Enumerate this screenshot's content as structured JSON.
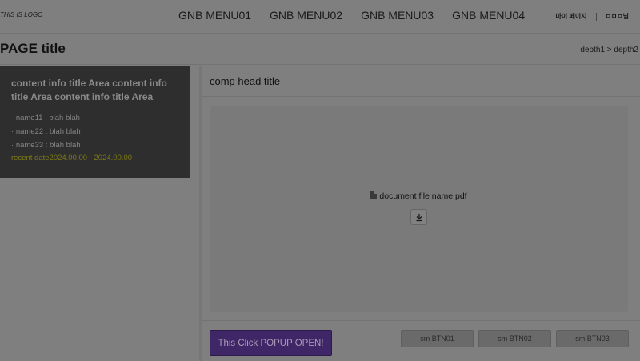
{
  "header": {
    "logo": "THIS IS LOGO",
    "menu": [
      {
        "label": "GNB MENU01"
      },
      {
        "label": "GNB MENU02"
      },
      {
        "label": "GNB MENU03"
      },
      {
        "label": "GNB MENU04"
      }
    ],
    "util": {
      "mypage": "마이 페이지",
      "user": "ㅁㅁㅁ님"
    }
  },
  "page": {
    "title": "PAGE title",
    "breadcrumb": "depth1 > depth2"
  },
  "info_panel": {
    "title": "content info title Area content info title Area content info title Area content in…",
    "items": [
      {
        "label": "name11 : blah blah"
      },
      {
        "label": "name22 : blah blah"
      },
      {
        "label": "name33 : blah blah"
      }
    ],
    "recent_date": "recent date2024.00.00 - 2024.00.00"
  },
  "comp": {
    "title": "comp head title",
    "file_name": "document file name.pdf",
    "file_icon": "document-icon",
    "download_icon": "download-icon"
  },
  "buttons": {
    "popup": "This Click POPUP OPEN!",
    "sm1": "sm BTN01",
    "sm2": "sm BTN02",
    "sm3": "sm BTN03"
  },
  "colors": {
    "overlay_bg": "#7f7f7f",
    "panel_bg": "#2e2e2e",
    "primary_button": "#3f2667",
    "accent_date": "#7c7a16"
  }
}
